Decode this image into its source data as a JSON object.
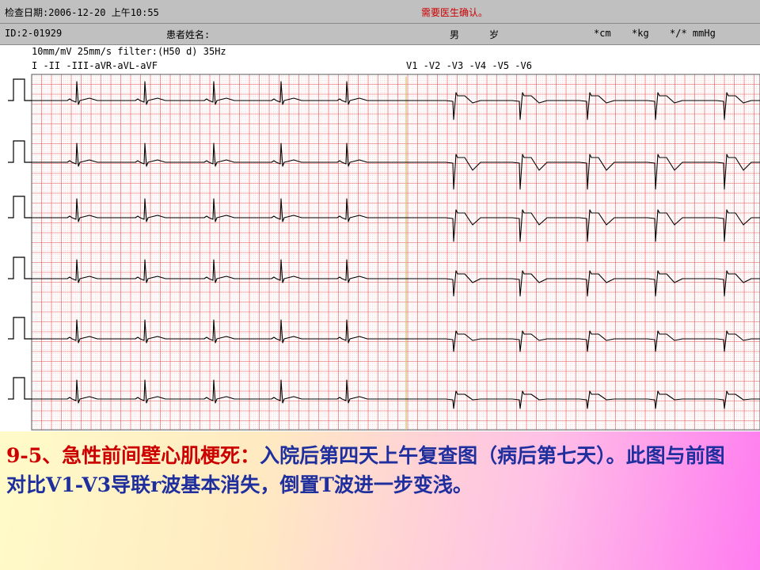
{
  "header": {
    "exam_date": "检查日期:2006-12-20  上午10:55",
    "notice": "需要医生确认。",
    "id": "ID:2-01929",
    "patient_name_label": "患者姓名:",
    "sex": "男",
    "age_unit": "岁",
    "height_unit": "*cm",
    "weight_unit": "*kg",
    "bp_unit": "*/* mmHg"
  },
  "ecg": {
    "settings": "10mm/mV 25mm/s filter:(H50 d) 35Hz",
    "limb_leads": "I  -II -III-aVR-aVL-aVF",
    "chest_leads": "V1 -V2 -V3 -V4 -V5 -V6",
    "rows": 6,
    "grid_color": "#e03030",
    "divider_color": "#c8c060"
  },
  "caption": {
    "id": "9-5、急性前间壁心肌梗死：",
    "text": "入院后第四天上午复查图（病后第七天）。此图与前图对比V1-V3导联r波基本消失，倒置T波进一步变浅。",
    "id_color": "#cc0000",
    "text_color": "#1f2f9e"
  }
}
